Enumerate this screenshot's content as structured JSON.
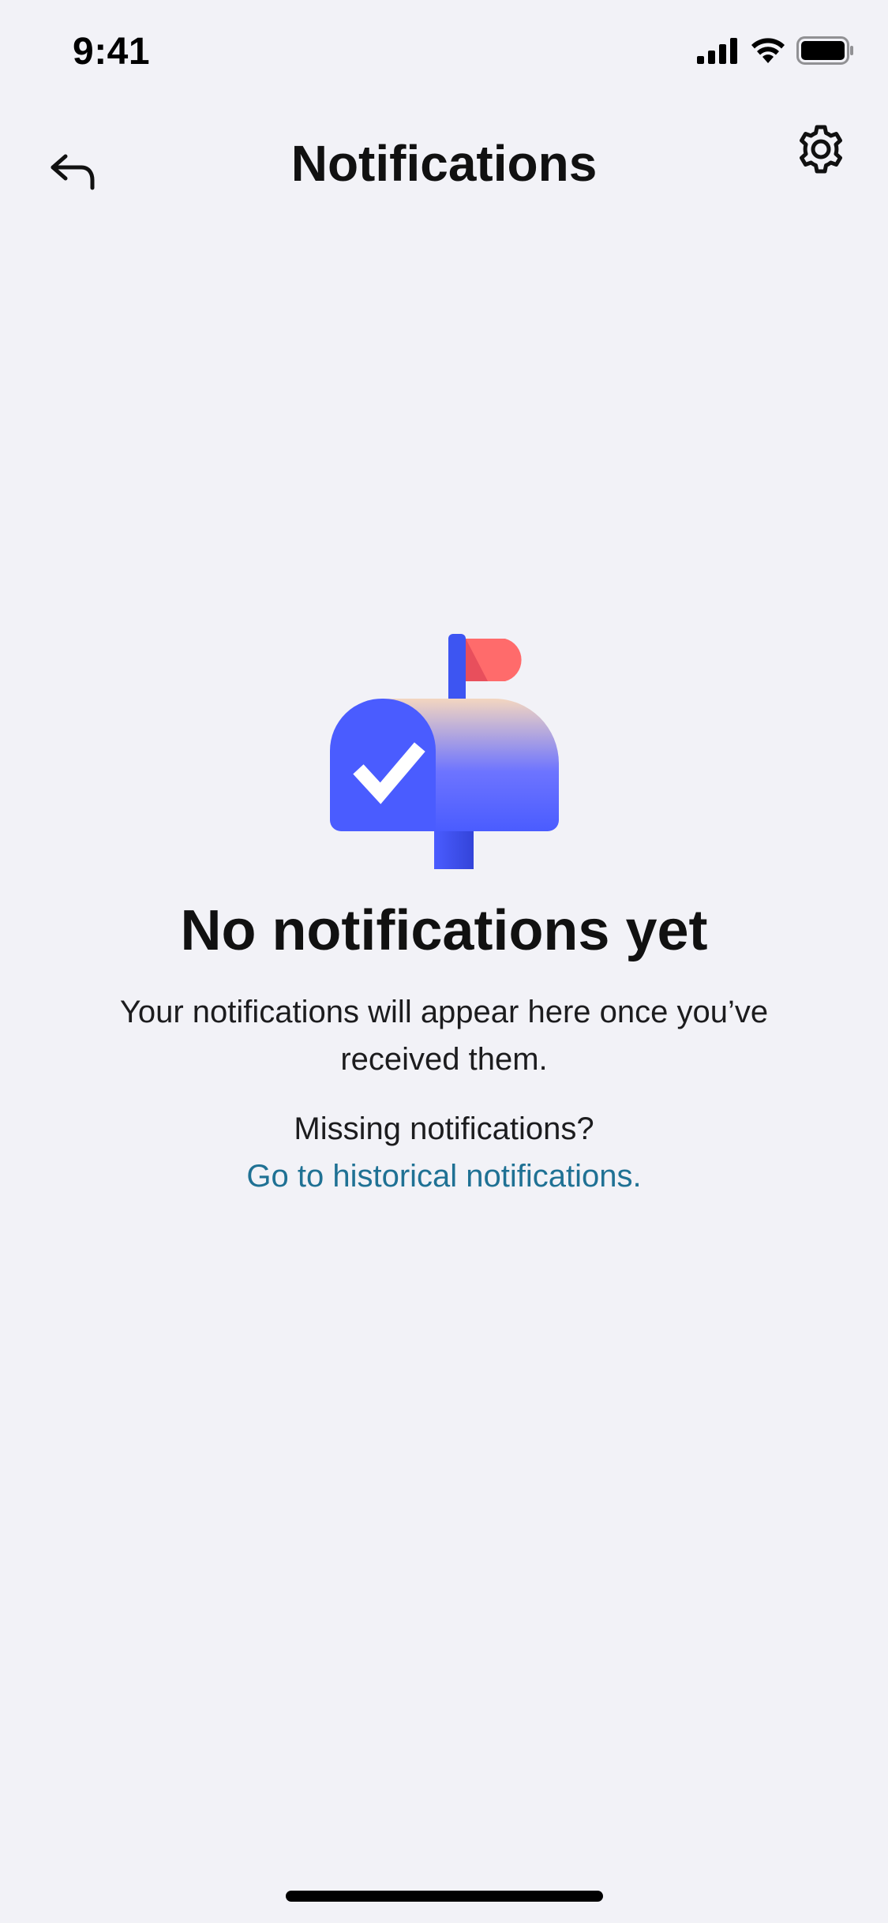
{
  "status_bar": {
    "time": "9:41",
    "icons": [
      "cellular-signal-icon",
      "wifi-icon",
      "battery-icon"
    ]
  },
  "nav": {
    "title": "Notifications",
    "back_icon": "back-arrow-icon",
    "settings_icon": "gear-icon"
  },
  "empty_state": {
    "illustration": "mailbox-checkmark-illustration",
    "title": "No notifications yet",
    "body": "Your notifications will appear here once you’ve received them.",
    "missing_label": "Missing notifications?",
    "link_label": "Go to historical notifications."
  },
  "colors": {
    "background": "#f2f2f7",
    "link": "#1f7194",
    "mailbox_blue": "#4a5cff",
    "flag_red": "#ff6b6b"
  }
}
